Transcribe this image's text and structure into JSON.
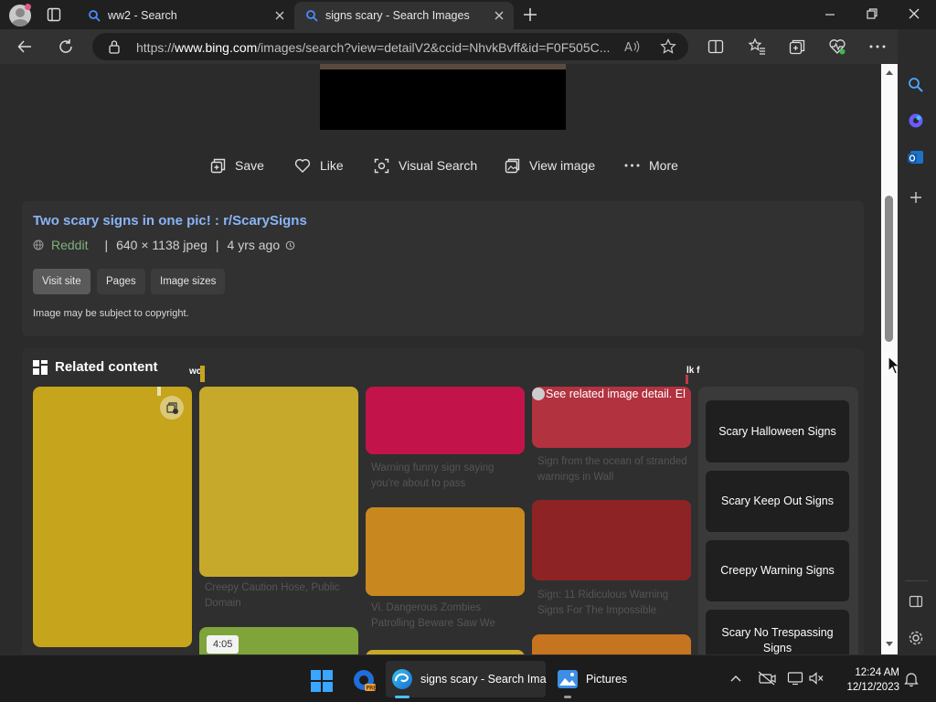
{
  "browser": {
    "tabs": [
      {
        "title": "ww2 - Search",
        "active": false
      },
      {
        "title": "signs scary - Search Images",
        "active": true
      }
    ],
    "url_prefix": "https://",
    "url_domain": "www.bing.com",
    "url_rest": "/images/search?view=detailV2&ccid=NhvkBvff&id=F0F505C..."
  },
  "actions": {
    "save": "Save",
    "like": "Like",
    "visual_search": "Visual Search",
    "view_image": "View image",
    "more": "More"
  },
  "info": {
    "title": "Two scary signs in one pic! : r/ScarySigns",
    "source": "Reddit",
    "dimensions": "640 × 1138 jpeg",
    "age": "4 yrs ago",
    "visit_site": "Visit site",
    "pages": "Pages",
    "image_sizes": "Image sizes",
    "copyright": "Image may be subject to copyright."
  },
  "related": {
    "heading": "Related content",
    "overflow_left": "wc",
    "overflow_right": "lk f",
    "alt_text": "See related image detail. El",
    "video_duration": "4:05",
    "captions": [
      "Creepy Caution Hose, Public Domain",
      "Warning funny sign saying you're about to pass",
      "Vi. Dangerous Zombies Patrolling Beware Saw We",
      "Sign from the ocean of stranded warnings in Wall",
      "Sign: 11 Ridiculous Warning Signs For The Impossible"
    ],
    "suggestions": [
      "Scary Halloween Signs",
      "Scary Keep Out Signs",
      "Creepy Warning Signs",
      "Scary No Trespassing Signs"
    ]
  },
  "taskbar": {
    "active_app": "signs scary - Search Ima",
    "pictures": "Pictures",
    "time": "12:24 AM",
    "date": "12/12/2023"
  },
  "colors": {
    "link": "#8ab4f8",
    "tile_mustard": "#c6a41b",
    "tile_mustard2": "#c6a92a",
    "tile_crimson": "#c2144b",
    "tile_orange": "#c8881f",
    "tile_red": "#b2323f",
    "tile_darkred": "#8e2326"
  }
}
